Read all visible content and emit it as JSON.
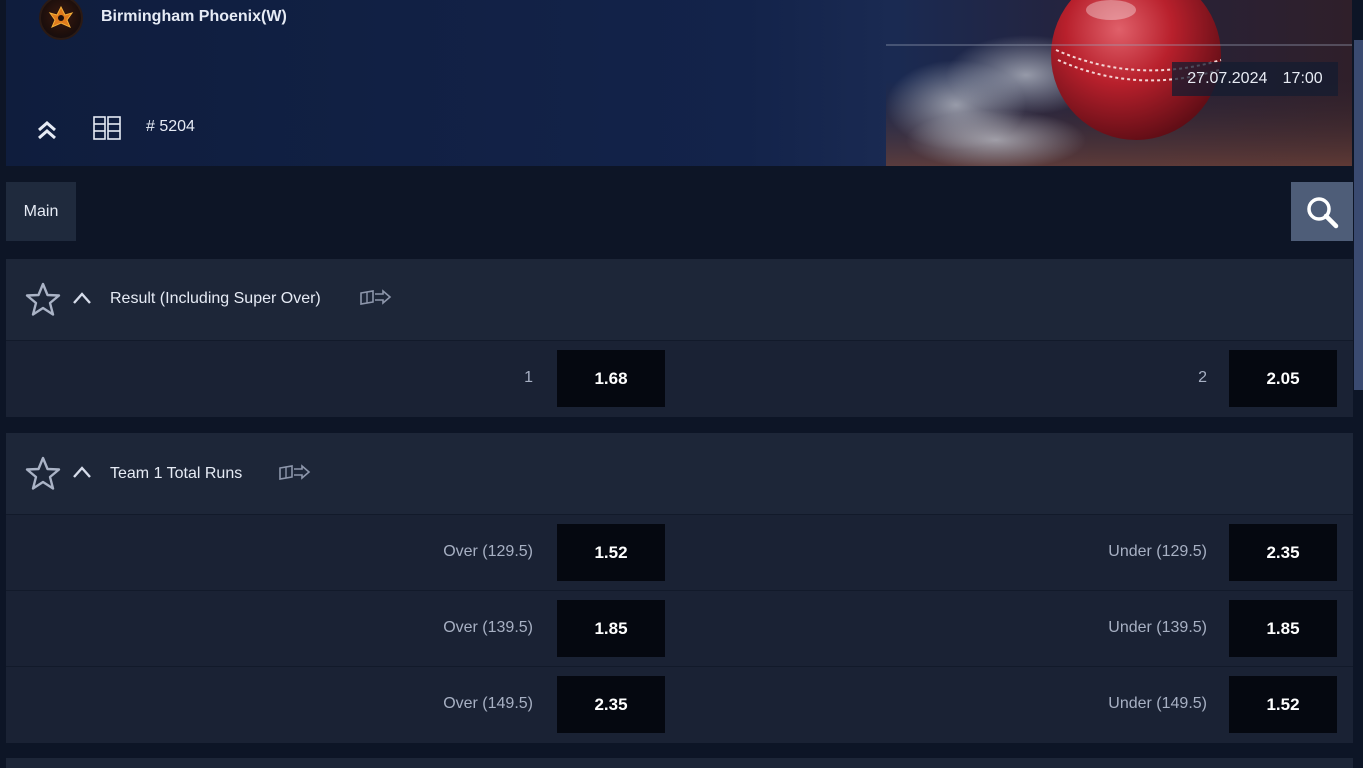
{
  "header": {
    "team_name": "Birmingham Phoenix(W)",
    "match_id": "# 5204",
    "date": "27.07.2024",
    "time": "17:00",
    "icons": [
      "team-logo",
      "double-chevron-up-icon",
      "grid-list-icon",
      "cricket-ball-art"
    ]
  },
  "tabs": {
    "main_label": "Main",
    "search_icon": "search-icon"
  },
  "markets": [
    {
      "title": "Result (Including Super Over)",
      "rows": [
        {
          "left_label": "1",
          "left_odd": "1.68",
          "right_label": "2",
          "right_odd": "2.05"
        }
      ]
    },
    {
      "title": "Team 1 Total Runs",
      "rows": [
        {
          "left_label": "Over (129.5)",
          "left_odd": "1.52",
          "right_label": "Under (129.5)",
          "right_odd": "2.35"
        },
        {
          "left_label": "Over (139.5)",
          "left_odd": "1.85",
          "right_label": "Under (139.5)",
          "right_odd": "1.85"
        },
        {
          "left_label": "Over (149.5)",
          "left_odd": "2.35",
          "right_label": "Under (149.5)",
          "right_odd": "1.52"
        }
      ]
    }
  ],
  "colors": {
    "background": "#0d1526",
    "market_bg": "#1a2234",
    "odd_button": "#050810",
    "search_button": "#4e5d78",
    "accent_red": "#c0202a"
  }
}
